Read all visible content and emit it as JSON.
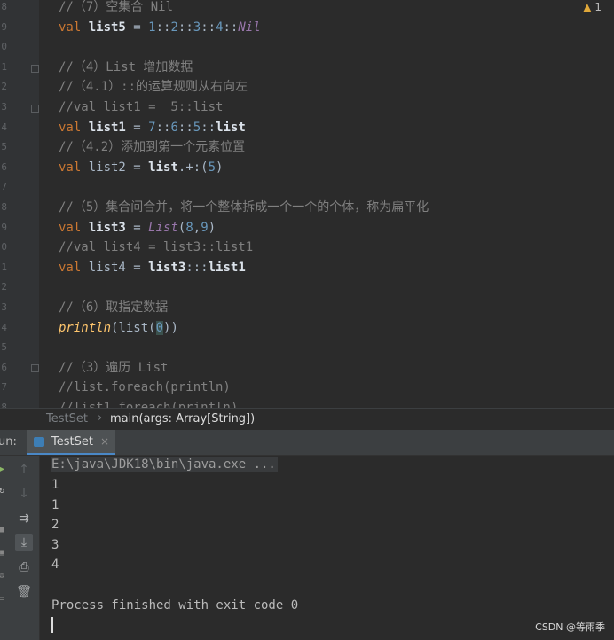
{
  "editor": {
    "warning": {
      "count": "1"
    },
    "lines": [
      {
        "segments": [
          {
            "t": "//（7）空集合 Nil",
            "c": "cm"
          }
        ]
      },
      {
        "segments": [
          {
            "t": "val ",
            "c": "kw"
          },
          {
            "t": "list5",
            "c": "id"
          },
          {
            "t": " = ",
            "c": "plain"
          },
          {
            "t": "1",
            "c": "num"
          },
          {
            "t": "::",
            "c": "plain"
          },
          {
            "t": "2",
            "c": "num"
          },
          {
            "t": "::",
            "c": "plain"
          },
          {
            "t": "3",
            "c": "num"
          },
          {
            "t": "::",
            "c": "plain"
          },
          {
            "t": "4",
            "c": "num"
          },
          {
            "t": "::",
            "c": "plain"
          },
          {
            "t": "Nil",
            "c": "it"
          }
        ]
      },
      {
        "segments": []
      },
      {
        "segments": [
          {
            "t": "//（4）List 增加数据",
            "c": "cm"
          }
        ]
      },
      {
        "segments": [
          {
            "t": "//（4.1）::的运算规则从右向左",
            "c": "cm"
          }
        ]
      },
      {
        "segments": [
          {
            "t": "//val list1 =  5::list",
            "c": "cm"
          }
        ]
      },
      {
        "segments": [
          {
            "t": "val ",
            "c": "kw"
          },
          {
            "t": "list1",
            "c": "id"
          },
          {
            "t": " = ",
            "c": "plain"
          },
          {
            "t": "7",
            "c": "num"
          },
          {
            "t": "::",
            "c": "plain"
          },
          {
            "t": "6",
            "c": "num"
          },
          {
            "t": "::",
            "c": "plain"
          },
          {
            "t": "5",
            "c": "num"
          },
          {
            "t": "::",
            "c": "plain"
          },
          {
            "t": "list",
            "c": "id"
          }
        ]
      },
      {
        "segments": [
          {
            "t": "//（4.2）添加到第一个元素位置",
            "c": "cm"
          }
        ]
      },
      {
        "segments": [
          {
            "t": "val ",
            "c": "kw"
          },
          {
            "t": "list2",
            "c": "muted"
          },
          {
            "t": " = ",
            "c": "plain"
          },
          {
            "t": "list",
            "c": "id"
          },
          {
            "t": ".+:(",
            "c": "plain"
          },
          {
            "t": "5",
            "c": "num"
          },
          {
            "t": ")",
            "c": "plain"
          }
        ]
      },
      {
        "segments": []
      },
      {
        "segments": [
          {
            "t": "//（5）集合间合并，将一个整体拆成一个一个的个体，称为扁平化",
            "c": "cm"
          }
        ]
      },
      {
        "segments": [
          {
            "t": "val ",
            "c": "kw"
          },
          {
            "t": "list3",
            "c": "id"
          },
          {
            "t": " = ",
            "c": "plain"
          },
          {
            "t": "List",
            "c": "it"
          },
          {
            "t": "(",
            "c": "plain"
          },
          {
            "t": "8",
            "c": "num"
          },
          {
            "t": ",",
            "c": "plain"
          },
          {
            "t": "9",
            "c": "num"
          },
          {
            "t": ")",
            "c": "plain"
          }
        ]
      },
      {
        "segments": [
          {
            "t": "//val list4 = list3::list1",
            "c": "cm"
          }
        ]
      },
      {
        "segments": [
          {
            "t": "val ",
            "c": "kw"
          },
          {
            "t": "list4",
            "c": "muted"
          },
          {
            "t": " = ",
            "c": "plain"
          },
          {
            "t": "list3",
            "c": "id"
          },
          {
            "t": ":::",
            "c": "plain"
          },
          {
            "t": "list1",
            "c": "id"
          }
        ]
      },
      {
        "segments": []
      },
      {
        "segments": [
          {
            "t": "//（6）取指定数据",
            "c": "cm"
          }
        ]
      },
      {
        "segments": [
          {
            "t": "println",
            "c": "fn"
          },
          {
            "t": "(list(",
            "c": "plain"
          },
          {
            "t": "0",
            "c": "num hl"
          },
          {
            "t": "))",
            "c": "plain"
          }
        ]
      },
      {
        "segments": []
      },
      {
        "segments": [
          {
            "t": "//（3）遍历 List",
            "c": "cm"
          }
        ]
      },
      {
        "segments": [
          {
            "t": "//list.foreach(println)",
            "c": "cm"
          }
        ]
      },
      {
        "segments": [
          {
            "t": "//list1.foreach(println)",
            "c": "cm"
          }
        ]
      }
    ],
    "line_numbers": [
      "8",
      "9",
      "0",
      "1",
      "2",
      "3",
      "4",
      "5",
      "6",
      "7",
      "8",
      "9",
      "0",
      "1",
      "2",
      "3",
      "4",
      "5",
      "6",
      "7",
      "8"
    ]
  },
  "breadcrumb": {
    "object": "TestSet",
    "method": "main(args: Array[String])"
  },
  "run_panel": {
    "label": "un:",
    "tab_label": "TestSet",
    "tab_close": "×"
  },
  "console": {
    "command": "E:\\java\\JDK18\\bin\\java.exe ...",
    "output": [
      "1",
      "1",
      "2",
      "3",
      "4",
      "",
      "Process finished with exit code 0"
    ]
  },
  "toolbar_icons": [
    "arrow-up-icon",
    "arrow-down-icon",
    "soft-wrap-icon",
    "scroll-to-end-icon",
    "print-icon",
    "trash-icon"
  ],
  "watermark": "CSDN @等雨季",
  "colors": {
    "keyword": "#cc7832",
    "comment": "#808080",
    "number": "#6897bb",
    "background": "#2b2b2b"
  }
}
